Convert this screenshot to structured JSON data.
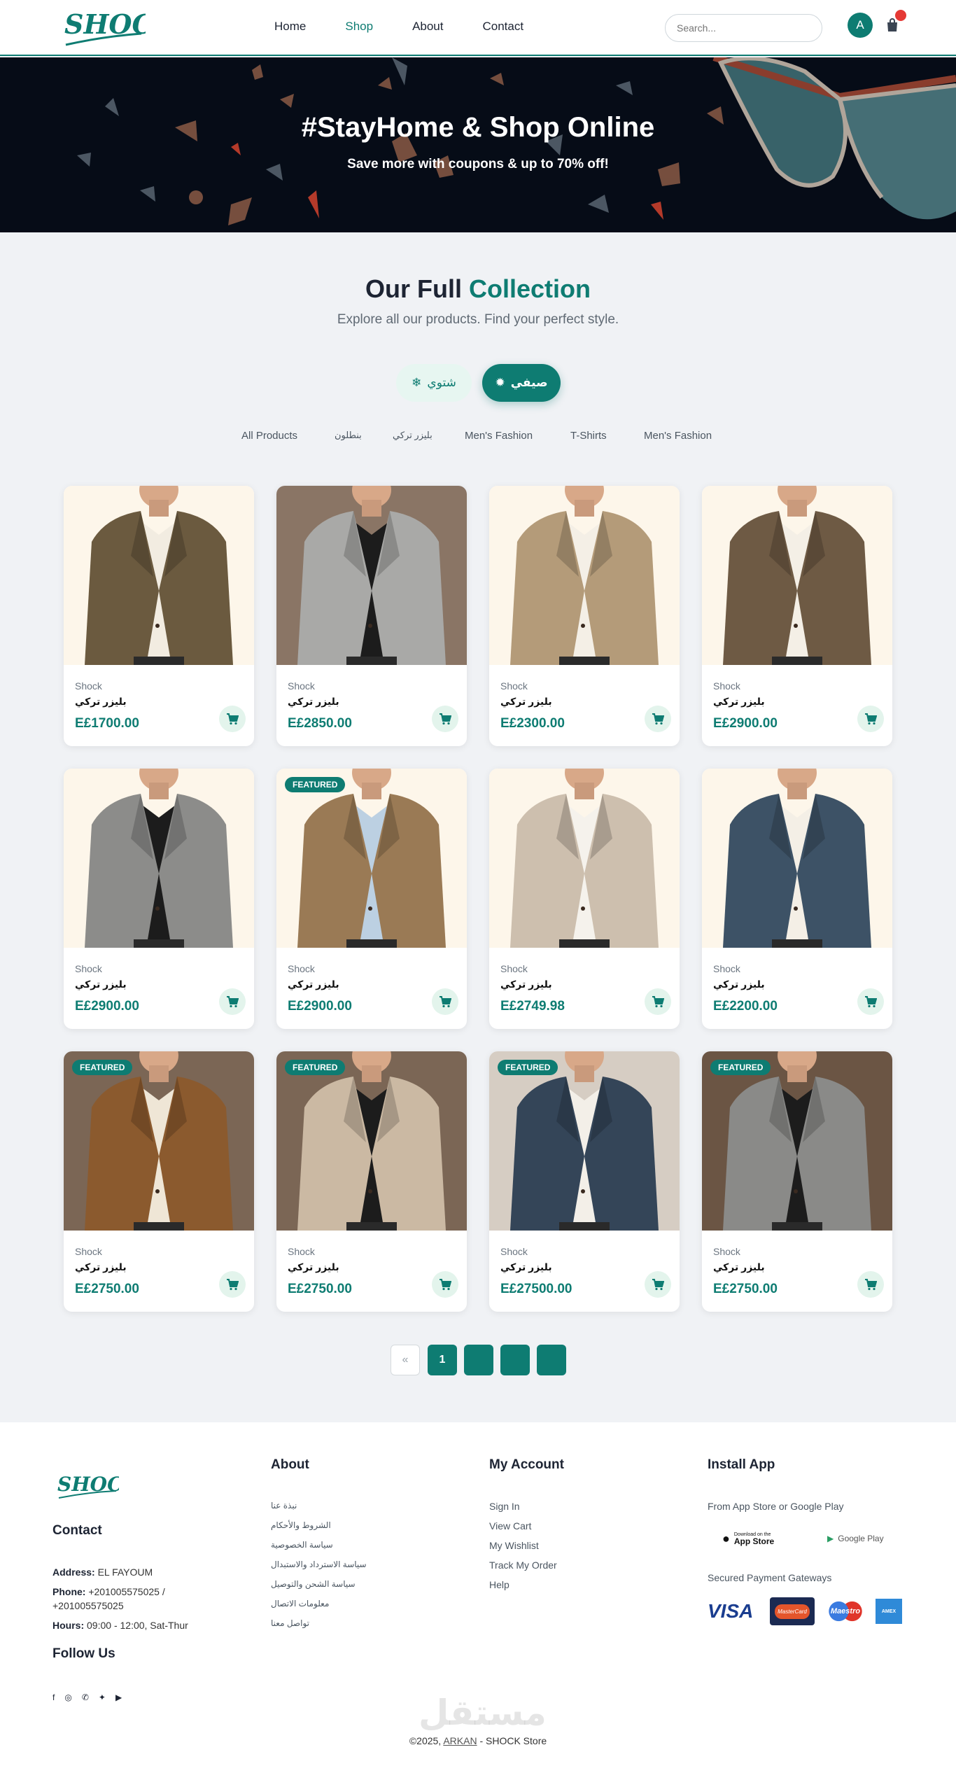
{
  "header": {
    "logo_text": "SHOCK",
    "nav": [
      {
        "label": "Home",
        "active": false
      },
      {
        "label": "Shop",
        "active": true
      },
      {
        "label": "About",
        "active": false
      },
      {
        "label": "Contact",
        "active": false
      }
    ],
    "search_placeholder": "Search...",
    "avatar_letter": "A"
  },
  "hero": {
    "title": "#StayHome & Shop Online",
    "subtitle": "Save more with coupons & up to 70% off!"
  },
  "collection": {
    "title_part1": "Our Full",
    "title_part2": "Collection",
    "subtitle": "Explore all our products. Find your perfect style.",
    "season_winter": "شتوي",
    "season_summer": "صيفي"
  },
  "filters": [
    "All Products",
    "بنطلون",
    "بليزر تركي",
    "Men's Fashion",
    "T-Shirts",
    "Men's Fashion"
  ],
  "products": [
    {
      "brand": "Shock",
      "name": "بليزر تركي",
      "price": "E£1700.00",
      "featured": false,
      "jacket": "#6b5a3f",
      "bg": "#fdf6ea",
      "shirt": "#f2ece1"
    },
    {
      "brand": "Shock",
      "name": "بليزر تركي",
      "price": "E£2850.00",
      "featured": false,
      "jacket": "#a9a9a7",
      "bg": "#8a7565",
      "shirt": "#1c1c1c"
    },
    {
      "brand": "Shock",
      "name": "بليزر تركي",
      "price": "E£2300.00",
      "featured": false,
      "jacket": "#b49b79",
      "bg": "#fdf6ea",
      "shirt": "#f4efe6"
    },
    {
      "brand": "Shock",
      "name": "بليزر تركي",
      "price": "E£2900.00",
      "featured": false,
      "jacket": "#6e5a44",
      "bg": "#fdf6ea",
      "shirt": "#f4efe6"
    },
    {
      "brand": "Shock",
      "name": "بليزر تركي",
      "price": "E£2900.00",
      "featured": false,
      "jacket": "#8c8c8a",
      "bg": "#fdf6ea",
      "shirt": "#1c1c1c"
    },
    {
      "brand": "Shock",
      "name": "بليزر تركي",
      "price": "E£2900.00",
      "featured": true,
      "jacket": "#9a7a55",
      "bg": "#fdf6ea",
      "shirt": "#bcd0e2"
    },
    {
      "brand": "Shock",
      "name": "بليزر تركي",
      "price": "E£2749.98",
      "featured": false,
      "jacket": "#cdbfae",
      "bg": "#fdf6ea",
      "shirt": "#f5f2ec"
    },
    {
      "brand": "Shock",
      "name": "بليزر تركي",
      "price": "E£2200.00",
      "featured": false,
      "jacket": "#3d5266",
      "bg": "#fdf6ea",
      "shirt": "#f4efe6"
    },
    {
      "brand": "Shock",
      "name": "بليزر تركي",
      "price": "E£2750.00",
      "featured": true,
      "jacket": "#8b5a2e",
      "bg": "#7b6655",
      "shirt": "#efe6d6"
    },
    {
      "brand": "Shock",
      "name": "بليزر تركي",
      "price": "E£2750.00",
      "featured": true,
      "jacket": "#cbb9a3",
      "bg": "#7b6655",
      "shirt": "#1c1c1c"
    },
    {
      "brand": "Shock",
      "name": "بليزر تركي",
      "price": "E£27500.00",
      "featured": true,
      "jacket": "#344558",
      "bg": "#d6cdc3",
      "shirt": "#f3efe8"
    },
    {
      "brand": "Shock",
      "name": "بليزر تركي",
      "price": "E£2750.00",
      "featured": true,
      "jacket": "#8a8a88",
      "bg": "#6b5544",
      "shirt": "#1c1c1c"
    }
  ],
  "featured_label": "FEATURED",
  "pagination": {
    "prev": "«",
    "pages": [
      "1",
      "",
      "",
      ""
    ]
  },
  "footer": {
    "logo_text": "SHOCK",
    "contact_title": "Contact",
    "address_label": "Address:",
    "address": "EL FAYOUM",
    "phone_label": "Phone:",
    "phone_line1": "+201005575025 /",
    "phone_line2": "+201005575025",
    "hours_label": "Hours:",
    "hours": "09:00 - 12:00, Sat-Thur",
    "follow_title": "Follow Us",
    "about_title": "About",
    "about_links": [
      "نبذة عنا",
      "الشروط والأحكام",
      "سياسة الخصوصية",
      "سياسة الاسترداد والاستبدال",
      "سياسة الشحن والتوصيل",
      "معلومات الاتصال",
      "تواصل معنا"
    ],
    "account_title": "My Account",
    "account_links": [
      "Sign In",
      "View Cart",
      "My Wishlist",
      "Track My Order",
      "Help"
    ],
    "app_title": "Install App",
    "app_sub": "From App Store or Google Play",
    "appstore_small": "Download on the",
    "appstore_big": "App Store",
    "googleplay": "Google Play",
    "payment_title": "Secured Payment Gateways",
    "payments": [
      "VISA",
      "MasterCard",
      "Maestro",
      "AMEX"
    ],
    "copyright_pre": "©2025,",
    "copyright_link": "ARKAN",
    "copyright_post": "- SHOCK Store",
    "watermark": "مستقل"
  },
  "colors": {
    "accent": "#0e7c72",
    "hero_bg": "#060c17",
    "badge_dot": "#e53935"
  }
}
